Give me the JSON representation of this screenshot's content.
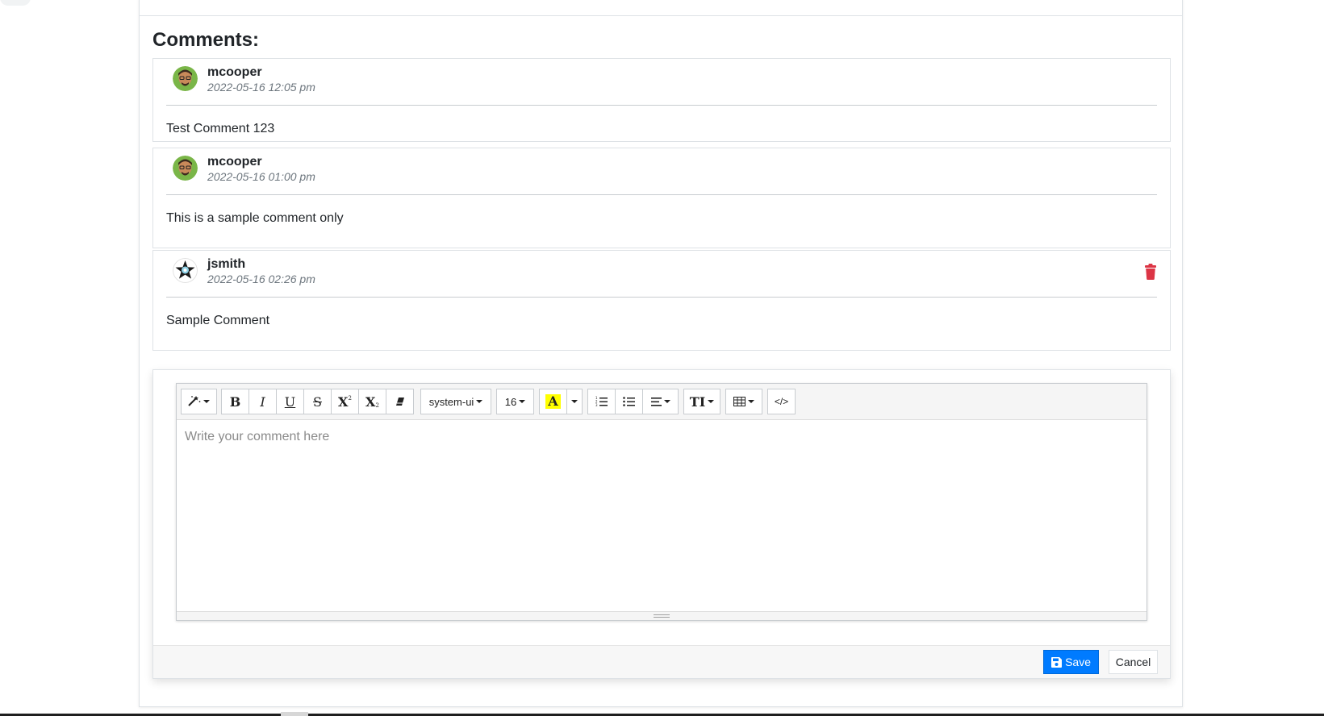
{
  "comments_section": {
    "heading": "Comments:",
    "items": [
      {
        "username": "mcooper",
        "timestamp": "2022-05-16 12:05 pm",
        "body": "Test Comment 123",
        "avatar_icon": "user-avatar-icon",
        "deletable": false
      },
      {
        "username": "mcooper",
        "timestamp": "2022-05-16 01:00 pm",
        "body": "This is a sample comment only",
        "avatar_icon": "user-avatar-icon",
        "deletable": false
      },
      {
        "username": "jsmith",
        "timestamp": "2022-05-16 02:26 pm",
        "body": "Sample Comment",
        "avatar_icon": "star-avatar-icon",
        "deletable": true
      }
    ],
    "delete_icon": "trash-icon",
    "delete_color": "#dc3545"
  },
  "editor": {
    "toolbar": {
      "style_icon": "magic-wand-icon",
      "bold_label": "B",
      "italic_label": "I",
      "underline_label": "U",
      "strikethrough_label": "S",
      "superscript_label": "X",
      "subscript_label": "X",
      "clear_format_icon": "eraser-icon",
      "font_family": "system-ui",
      "font_size": "16",
      "highlight_label": "A",
      "highlight_color": "#ffff00",
      "ordered_list_icon": "ordered-list-icon",
      "unordered_list_icon": "unordered-list-icon",
      "paragraph_icon": "align-icon",
      "line_height_label": "TI",
      "table_icon": "table-icon",
      "code_view_label": "</>"
    },
    "placeholder": "Write your comment here",
    "save_label": "Save",
    "cancel_label": "Cancel",
    "save_color": "#007bff"
  }
}
